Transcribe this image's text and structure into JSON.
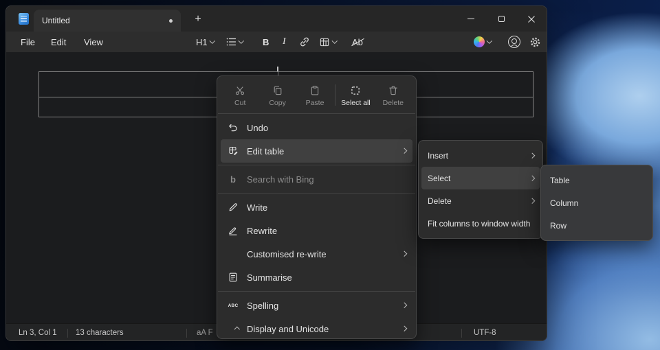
{
  "colors": {
    "menu_background": "#2c2c2c",
    "menu_highlight": "#404040",
    "window_background": "#1b1c1e",
    "titlebar_background": "#262626",
    "notepad_icon_blue": "#3b8de0",
    "wallpaper_blue": "#79a8dc"
  },
  "titlebar": {
    "tab_title": "Untitled",
    "new_tab_glyph": "+"
  },
  "menubar": {
    "items": [
      {
        "label": "File"
      },
      {
        "label": "Edit"
      },
      {
        "label": "View"
      }
    ]
  },
  "toolbar": {
    "heading_label": "H1",
    "bold_label": "B",
    "italic_label": "I",
    "clear_format_label": "Ab"
  },
  "context_menu": {
    "top_buttons": [
      {
        "label": "Cut",
        "enabled": false
      },
      {
        "label": "Copy",
        "enabled": false
      },
      {
        "label": "Paste",
        "enabled": false
      },
      {
        "label": "Select all",
        "enabled": true
      },
      {
        "label": "Delete",
        "enabled": false
      }
    ],
    "items": [
      {
        "label": "Undo",
        "has_submenu": false
      },
      {
        "label": "Edit table",
        "has_submenu": true,
        "highlighted": true
      },
      {
        "label": "Search with Bing",
        "disabled": true
      },
      {
        "label": "Write"
      },
      {
        "label": "Rewrite"
      },
      {
        "label": "Customised re-write",
        "has_submenu": true
      },
      {
        "label": "Summarise"
      },
      {
        "label": "Spelling",
        "has_submenu": true
      },
      {
        "label": "Display and Unicode",
        "has_submenu": true
      }
    ],
    "bing_glyph": "b",
    "spelling_glyph": "ABC"
  },
  "edit_table_submenu": {
    "items": [
      {
        "label": "Insert",
        "has_submenu": true
      },
      {
        "label": "Select",
        "has_submenu": true,
        "highlighted": true
      },
      {
        "label": "Delete",
        "has_submenu": true
      },
      {
        "label": "Fit columns to window width",
        "has_submenu": false
      }
    ]
  },
  "select_submenu": {
    "items": [
      {
        "label": "Table"
      },
      {
        "label": "Column"
      },
      {
        "label": "Row"
      }
    ]
  },
  "statusbar": {
    "cursor_position": "Ln 3, Col 1",
    "character_count": "13 characters",
    "fragment": "aA  F",
    "encoding": "UTF-8"
  }
}
